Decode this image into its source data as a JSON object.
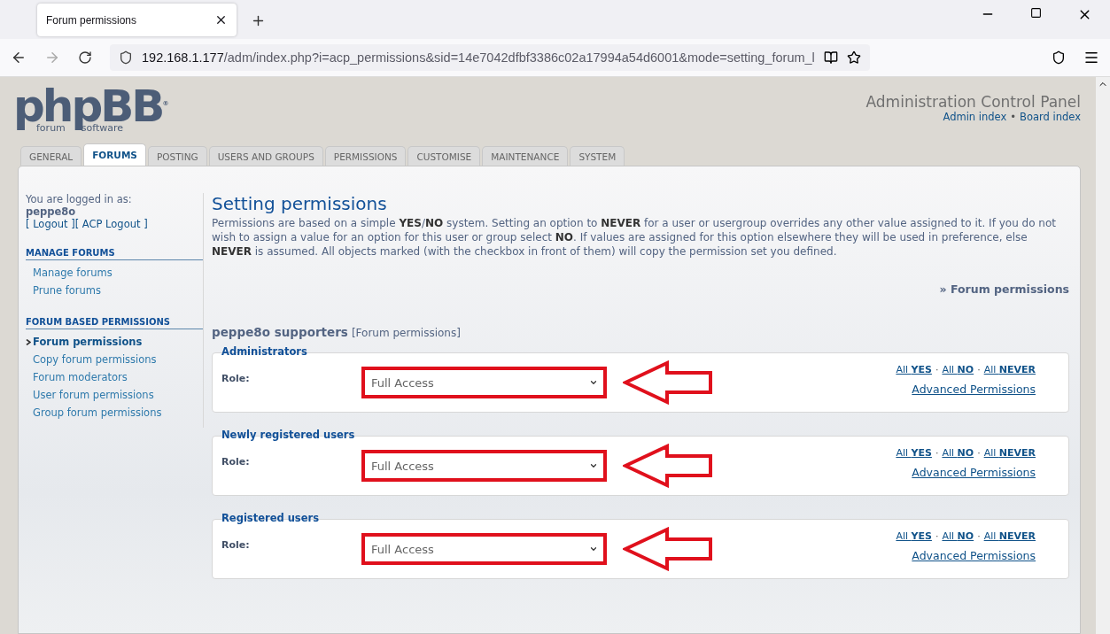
{
  "browser": {
    "tab_title": "Forum permissions",
    "url_host": "192.168.1.177",
    "url_path": "/adm/index.php?i=acp_permissions&sid=14e7042dfbf3386c02a17994a54d6001&mode=setting_forum_l"
  },
  "logo": {
    "name": "phpBB",
    "word_left": "forum",
    "word_right": "software",
    "mark": "®"
  },
  "header": {
    "title": "Administration Control Panel",
    "links": [
      "Admin index",
      "Board index"
    ],
    "separator": "•"
  },
  "tabs": [
    {
      "label": "GENERAL",
      "selected": false
    },
    {
      "label": "FORUMS",
      "selected": true
    },
    {
      "label": "POSTING",
      "selected": false
    },
    {
      "label": "USERS AND GROUPS",
      "selected": false
    },
    {
      "label": "PERMISSIONS",
      "selected": false
    },
    {
      "label": "CUSTOMISE",
      "selected": false
    },
    {
      "label": "MAINTENANCE",
      "selected": false
    },
    {
      "label": "SYSTEM",
      "selected": false
    }
  ],
  "sidebar": {
    "login_label": "You are logged in as:",
    "username": "peppe8o",
    "logout_links": [
      "[ Logout ]",
      "[ ACP Logout ]"
    ],
    "sections": [
      {
        "title": "MANAGE FORUMS",
        "items": [
          {
            "label": "Manage forums",
            "selected": false
          },
          {
            "label": "Prune forums",
            "selected": false
          }
        ]
      },
      {
        "title": "FORUM BASED PERMISSIONS",
        "items": [
          {
            "label": "Forum permissions",
            "selected": true
          },
          {
            "label": "Copy forum permissions",
            "selected": false
          },
          {
            "label": "Forum moderators",
            "selected": false
          },
          {
            "label": "User forum permissions",
            "selected": false
          },
          {
            "label": "Group forum permissions",
            "selected": false
          }
        ]
      }
    ]
  },
  "content": {
    "title": "Setting permissions",
    "description": "Permissions are based on a simple **YES**/**NO** system. Setting an option to **NEVER** for a user or usergroup overrides any other value assigned to it. If you do not wish to assign a value for an option for this user or group select **NO**. If values are assigned for this option elsewhere they will be used in preference, else **NEVER** is assumed. All objects marked (with the checkbox in front of them) will copy the permission set you defined.",
    "breadcrumb": "» Forum permissions",
    "forum_name": "peppe8o supporters",
    "forum_tag": "[Forum permissions]",
    "groups": [
      {
        "name": "Administrators",
        "role_label": "Role:",
        "role": "Full Access",
        "highlighted": true,
        "links": [
          "All **YES**",
          "All **NO**",
          "All **NEVER**"
        ],
        "separator": "·",
        "advanced": "Advanced Permissions"
      },
      {
        "name": "Newly registered users",
        "role_label": "Role:",
        "role": "Full Access",
        "highlighted": true,
        "links": [
          "All **YES**",
          "All **NO**",
          "All **NEVER**"
        ],
        "separator": "·",
        "advanced": "Advanced Permissions"
      },
      {
        "name": "Registered users",
        "role_label": "Role:",
        "role": "Full Access",
        "highlighted": true,
        "links": [
          "All **YES**",
          "All **NO**",
          "All **NEVER**"
        ],
        "separator": "·",
        "advanced": "Advanced Permissions"
      }
    ]
  }
}
